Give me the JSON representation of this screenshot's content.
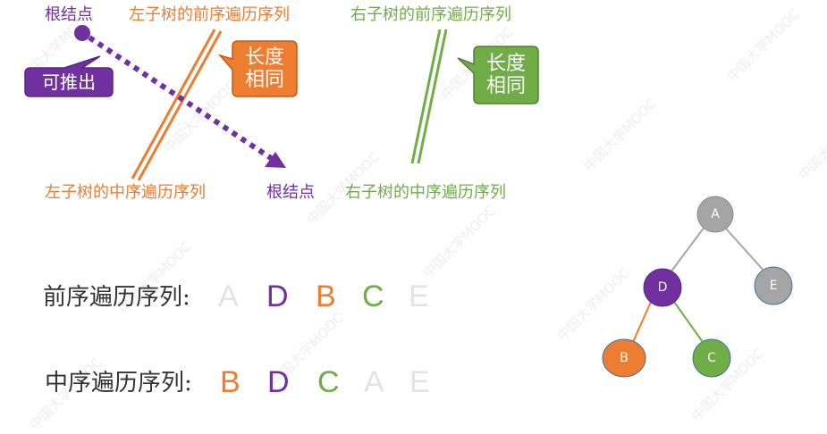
{
  "colors": {
    "purple": "#7030a0",
    "orange": "#ed7d31",
    "green": "#70ad47",
    "gray": "#a5a5a5",
    "faint": "#d9d9d9",
    "text": "#333333"
  },
  "labels": {
    "root_top": "根结点",
    "left_preorder": "左子树的前序遍历序列",
    "right_preorder": "右子树的前序遍历序列",
    "left_inorder": "左子树的中序遍历序列",
    "root_bottom": "根结点",
    "right_inorder": "右子树的中序遍历序列"
  },
  "callouts": {
    "derive": "可推出",
    "orange_line1": "长度",
    "orange_line2": "相同",
    "green_line1": "长度",
    "green_line2": "相同"
  },
  "sequences": {
    "preorder_label": "前序遍历序列:",
    "preorder_letters": [
      "A",
      "D",
      "B",
      "C",
      "E"
    ],
    "inorder_label": "中序遍历序列:",
    "inorder_letters": [
      "B",
      "D",
      "C",
      "A",
      "E"
    ]
  },
  "tree": {
    "nodes": [
      {
        "id": "A",
        "label": "A",
        "color": "gray"
      },
      {
        "id": "D",
        "label": "D",
        "color": "purple"
      },
      {
        "id": "E",
        "label": "E",
        "color": "gray"
      },
      {
        "id": "B",
        "label": "B",
        "color": "orange"
      },
      {
        "id": "C",
        "label": "C",
        "color": "green"
      }
    ],
    "edges": [
      {
        "from": "A",
        "to": "D",
        "color": "gray"
      },
      {
        "from": "A",
        "to": "E",
        "color": "gray"
      },
      {
        "from": "D",
        "to": "B",
        "color": "orange"
      },
      {
        "from": "D",
        "to": "C",
        "color": "green"
      }
    ]
  },
  "watermark": "中国大学MOOC"
}
